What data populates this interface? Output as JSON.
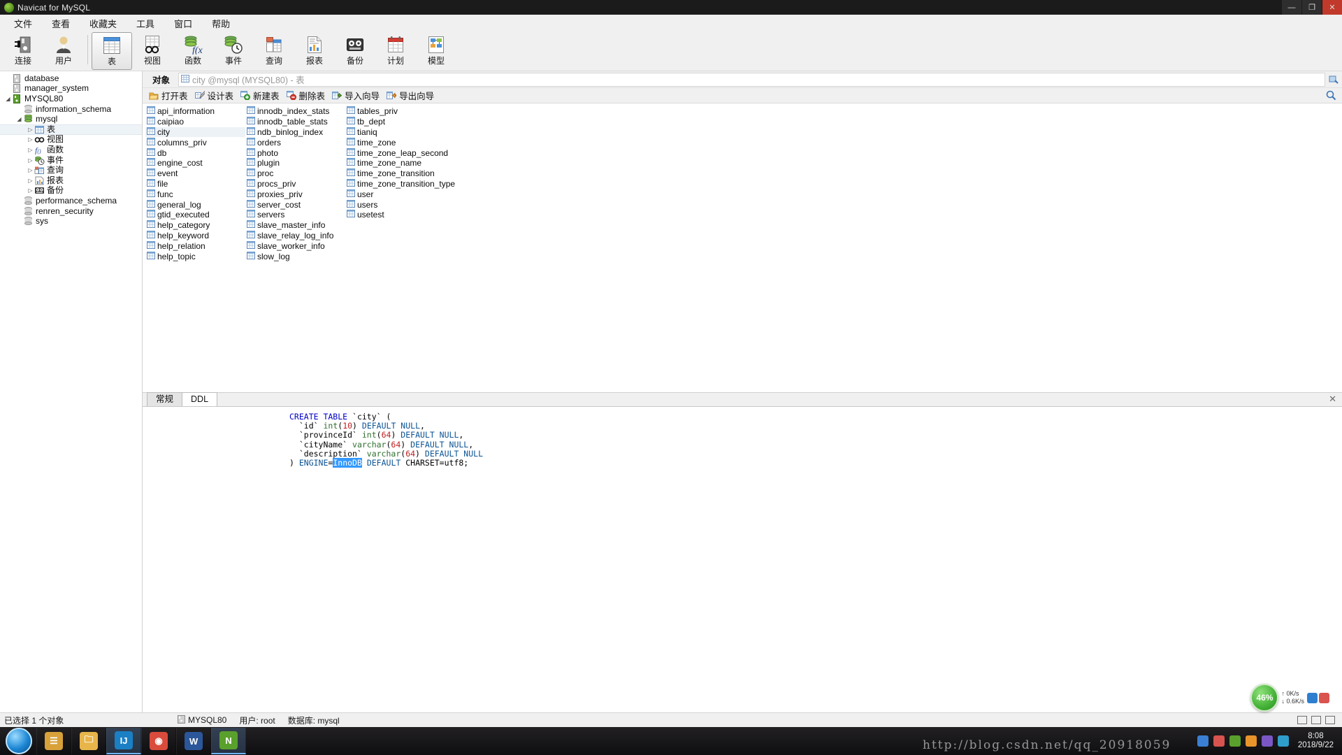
{
  "window": {
    "title": "Navicat for MySQL",
    "controls": {
      "minimize": "—",
      "maximize": "❐",
      "close": "✕"
    }
  },
  "menubar": {
    "items": [
      {
        "label": "文件",
        "name": "menu-file"
      },
      {
        "label": "查看",
        "name": "menu-view"
      },
      {
        "label": "收藏夹",
        "name": "menu-favorites"
      },
      {
        "label": "工具",
        "name": "menu-tools"
      },
      {
        "label": "窗口",
        "name": "menu-window"
      },
      {
        "label": "帮助",
        "name": "menu-help"
      }
    ]
  },
  "toolbar": {
    "buttons": [
      {
        "label": "连接",
        "icon": "connection-icon",
        "active": false
      },
      {
        "label": "用户",
        "icon": "user-icon",
        "active": false
      },
      {
        "label": "表",
        "icon": "table-icon",
        "active": true
      },
      {
        "label": "视图",
        "icon": "view-icon",
        "active": false
      },
      {
        "label": "函数",
        "icon": "function-icon",
        "active": false
      },
      {
        "label": "事件",
        "icon": "event-icon",
        "active": false
      },
      {
        "label": "查询",
        "icon": "query-icon",
        "active": false
      },
      {
        "label": "报表",
        "icon": "report-icon",
        "active": false
      },
      {
        "label": "备份",
        "icon": "backup-icon",
        "active": false
      },
      {
        "label": "计划",
        "icon": "schedule-icon",
        "active": false
      },
      {
        "label": "模型",
        "icon": "model-icon",
        "active": false
      }
    ]
  },
  "sidebar": {
    "tree": [
      {
        "label": "database",
        "indent": 1,
        "icon": "server-icon-grey",
        "expander": "",
        "selected": false
      },
      {
        "label": "manager_system",
        "indent": 1,
        "icon": "server-icon-grey",
        "expander": "",
        "selected": false
      },
      {
        "label": "MYSQL80",
        "indent": 1,
        "icon": "server-icon-green",
        "expander": "▴",
        "selected": false
      },
      {
        "label": "information_schema",
        "indent": 2,
        "icon": "database-icon-grey",
        "expander": "",
        "selected": false
      },
      {
        "label": "mysql",
        "indent": 2,
        "icon": "database-icon-green",
        "expander": "▴",
        "selected": false
      },
      {
        "label": "表",
        "indent": 3,
        "icon": "table-icon",
        "expander": "▸",
        "selected": true
      },
      {
        "label": "视图",
        "indent": 3,
        "icon": "view-icon",
        "expander": "▸",
        "selected": false
      },
      {
        "label": "函数",
        "indent": 3,
        "icon": "function-icon",
        "expander": "▸",
        "selected": false
      },
      {
        "label": "事件",
        "indent": 3,
        "icon": "event-icon",
        "expander": "▸",
        "selected": false
      },
      {
        "label": "查询",
        "indent": 3,
        "icon": "query-icon",
        "expander": "▸",
        "selected": false
      },
      {
        "label": "报表",
        "indent": 3,
        "icon": "report-icon",
        "expander": "▸",
        "selected": false
      },
      {
        "label": "备份",
        "indent": 3,
        "icon": "backup-icon",
        "expander": "▸",
        "selected": false
      },
      {
        "label": "performance_schema",
        "indent": 2,
        "icon": "database-icon-grey",
        "expander": "",
        "selected": false
      },
      {
        "label": "renren_security",
        "indent": 2,
        "icon": "database-icon-grey",
        "expander": "",
        "selected": false
      },
      {
        "label": "sys",
        "indent": 2,
        "icon": "database-icon-grey",
        "expander": "",
        "selected": false
      }
    ]
  },
  "objectbar": {
    "label": "对象",
    "path": "city @mysql (MYSQL80) - 表",
    "icon": "grid-icon"
  },
  "actionbar": {
    "buttons": [
      {
        "label": "打开表",
        "icon": "open-table-icon"
      },
      {
        "label": "设计表",
        "icon": "design-table-icon"
      },
      {
        "label": "新建表",
        "icon": "new-table-icon"
      },
      {
        "label": "删除表",
        "icon": "delete-table-icon"
      },
      {
        "label": "导入向导",
        "icon": "import-wizard-icon"
      },
      {
        "label": "导出向导",
        "icon": "export-wizard-icon"
      }
    ],
    "search_icon": "search-icon"
  },
  "tablelist": {
    "selected": "city",
    "columns": [
      [
        "api_information",
        "caipiao",
        "city",
        "columns_priv",
        "db",
        "engine_cost",
        "event",
        "file",
        "func",
        "general_log",
        "gtid_executed",
        "help_category",
        "help_keyword",
        "help_relation",
        "help_topic"
      ],
      [
        "innodb_index_stats",
        "innodb_table_stats",
        "ndb_binlog_index",
        "orders",
        "photo",
        "plugin",
        "proc",
        "procs_priv",
        "proxies_priv",
        "server_cost",
        "servers",
        "slave_master_info",
        "slave_relay_log_info",
        "slave_worker_info",
        "slow_log"
      ],
      [
        "tables_priv",
        "tb_dept",
        "tianiq",
        "time_zone",
        "time_zone_leap_second",
        "time_zone_name",
        "time_zone_transition",
        "time_zone_transition_type",
        "user",
        "users",
        "usetest"
      ]
    ]
  },
  "ddl_panel": {
    "tabs": [
      {
        "label": "常规",
        "active": false
      },
      {
        "label": "DDL",
        "active": true
      }
    ],
    "close_label": "✕",
    "sql_lines": [
      [
        {
          "t": "CREATE TABLE ",
          "c": "kw"
        },
        {
          "t": "`city`",
          "c": "ident"
        },
        {
          "t": " (",
          "c": "ident"
        }
      ],
      [
        {
          "t": "  `id` ",
          "c": "ident"
        },
        {
          "t": "int",
          "c": "typ"
        },
        {
          "t": "(",
          "c": "ident"
        },
        {
          "t": "10",
          "c": "num"
        },
        {
          "t": ") ",
          "c": "ident"
        },
        {
          "t": "DEFAULT NULL",
          "c": "kw2"
        },
        {
          "t": ",",
          "c": "ident"
        }
      ],
      [
        {
          "t": "  `provinceId` ",
          "c": "ident"
        },
        {
          "t": "int",
          "c": "typ"
        },
        {
          "t": "(",
          "c": "ident"
        },
        {
          "t": "64",
          "c": "num"
        },
        {
          "t": ") ",
          "c": "ident"
        },
        {
          "t": "DEFAULT NULL",
          "c": "kw2"
        },
        {
          "t": ",",
          "c": "ident"
        }
      ],
      [
        {
          "t": "  `cityName` ",
          "c": "ident"
        },
        {
          "t": "varchar",
          "c": "typ"
        },
        {
          "t": "(",
          "c": "ident"
        },
        {
          "t": "64",
          "c": "num"
        },
        {
          "t": ") ",
          "c": "ident"
        },
        {
          "t": "DEFAULT NULL",
          "c": "kw2"
        },
        {
          "t": ",",
          "c": "ident"
        }
      ],
      [
        {
          "t": "  `description` ",
          "c": "ident"
        },
        {
          "t": "varchar",
          "c": "typ"
        },
        {
          "t": "(",
          "c": "ident"
        },
        {
          "t": "64",
          "c": "num"
        },
        {
          "t": ") ",
          "c": "ident"
        },
        {
          "t": "DEFAULT NULL",
          "c": "kw2"
        }
      ],
      [
        {
          "t": ") ",
          "c": "ident"
        },
        {
          "t": "ENGINE",
          "c": "kw2"
        },
        {
          "t": "=",
          "c": "ident"
        },
        {
          "t": "InnoDB",
          "c": "sel"
        },
        {
          "t": " ",
          "c": "ident"
        },
        {
          "t": "DEFAULT",
          "c": "kw2"
        },
        {
          "t": " CHARSET=utf8;",
          "c": "ident"
        }
      ]
    ]
  },
  "statusbar": {
    "left": "已选择 1 个对象",
    "server": "MYSQL80",
    "user": "用户: root",
    "database": "数据库: mysql",
    "server_icon": "server-icon-grey"
  },
  "speed_widget": {
    "percent": "46%",
    "up_rate": "0K/s",
    "down_rate": "0.6K/s",
    "up_arrow": "↑",
    "down_arrow": "↓"
  },
  "taskbar": {
    "items": [
      {
        "name": "taskbar-item-explorer",
        "glyph": "☰",
        "color": "#d8a13a",
        "active": false
      },
      {
        "name": "taskbar-item-folder",
        "glyph": "🗀",
        "color": "#e8b54a",
        "active": false
      },
      {
        "name": "taskbar-item-idea",
        "glyph": "IJ",
        "color": "#1b7fc4",
        "active": true
      },
      {
        "name": "taskbar-item-chrome",
        "glyph": "◉",
        "color": "#d94b3c",
        "active": false
      },
      {
        "name": "taskbar-item-word",
        "glyph": "W",
        "color": "#2b579a",
        "active": false
      },
      {
        "name": "taskbar-item-navicat",
        "glyph": "N",
        "color": "#5aa02c",
        "active": true
      }
    ],
    "clock_time": "8:08",
    "clock_date": "2018/9/22",
    "watermark": "http://blog.csdn.net/qq_20918059"
  }
}
